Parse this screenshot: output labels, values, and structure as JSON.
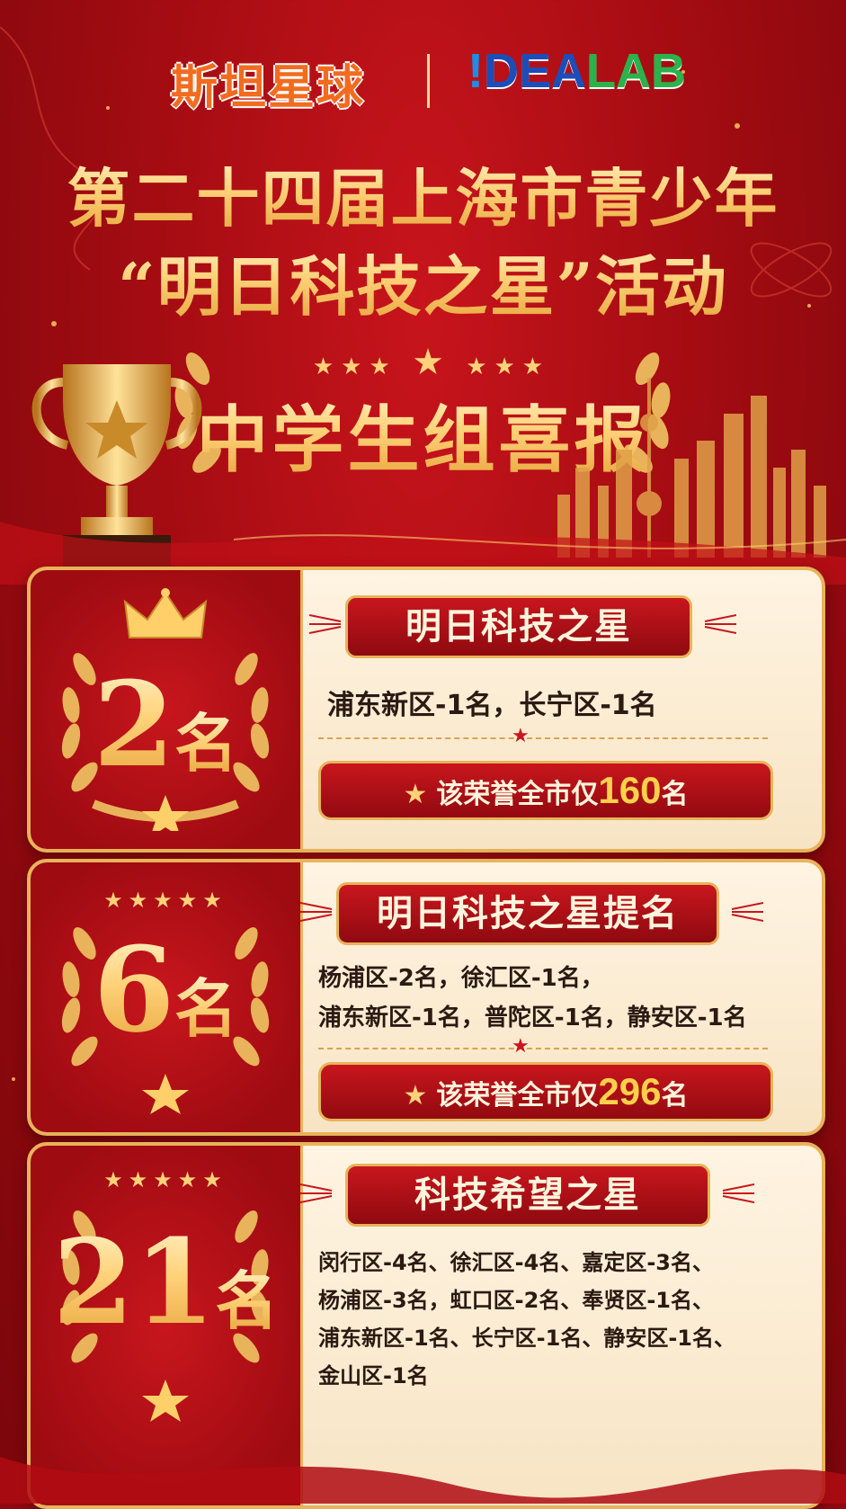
{
  "header": {
    "brand_cn": "斯坦星球",
    "brand_en_bang": "!",
    "brand_en_dea": "DEA",
    "brand_en_lab": "LAB",
    "title_line1": "第二十四届上海市青少年",
    "title_line2": "“明日科技之星”活动",
    "heading": "中学生组喜报",
    "stars": "★★★",
    "big_star": "★"
  },
  "cards": [
    {
      "count_num": "2",
      "count_unit": "名",
      "award": "明日科技之星",
      "detail_lines": [
        "浦东新区-1名，长宁区-1名"
      ],
      "honor_prefix": "该荣誉全市仅",
      "honor_number": "160",
      "honor_suffix": "名"
    },
    {
      "count_num": "6",
      "count_unit": "名",
      "award": "明日科技之星提名",
      "detail_lines": [
        "杨浦区-2名，徐汇区-1名，",
        "浦东新区-1名，普陀区-1名，静安区-1名"
      ],
      "honor_prefix": "该荣誉全市仅",
      "honor_number": "296",
      "honor_suffix": "名"
    },
    {
      "count_num": "21",
      "count_unit": "名",
      "award": "科技希望之星",
      "detail_lines": [
        "闵行区-4名、徐汇区-4名、嘉定区-3名、",
        "杨浦区-3名，虹口区-2名、奉贤区-1名、",
        "浦东新区-1名、长宁区-1名、静安区-1名、",
        "金山区-1名"
      ]
    }
  ],
  "colors": {
    "background_red": "#a40c12",
    "gold": "#ffd27a",
    "cream": "#fff4e2",
    "brand_orange": "#f36b1f",
    "brand_blue": "#1b4eb8",
    "brand_green": "#2bb24a"
  },
  "icons": [
    "trophy-icon",
    "laurel-icon",
    "crown-icon",
    "star-icon",
    "city-skyline-icon"
  ]
}
